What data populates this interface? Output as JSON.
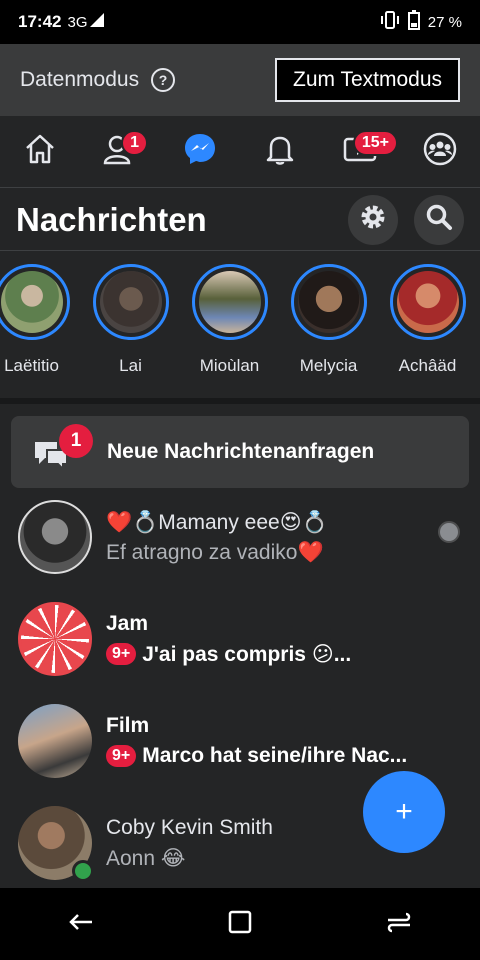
{
  "status_bar": {
    "time": "17:42",
    "network": "3G",
    "network_sup": "3G",
    "battery": "27 %"
  },
  "data_mode": {
    "label": "Datenmodus",
    "help_glyph": "?",
    "text_mode_button": "Zum Textmodus"
  },
  "nav": {
    "items": [
      {
        "name": "home",
        "badge": ""
      },
      {
        "name": "friends",
        "badge": "1"
      },
      {
        "name": "messenger",
        "badge": ""
      },
      {
        "name": "notifications",
        "badge": ""
      },
      {
        "name": "watch",
        "badge": "15+"
      },
      {
        "name": "groups",
        "badge": ""
      }
    ]
  },
  "header": {
    "title": "Nachrichten"
  },
  "stories": [
    {
      "name": "Laëtitio"
    },
    {
      "name": "Lai"
    },
    {
      "name": "Mioùlan"
    },
    {
      "name": "Melycia"
    },
    {
      "name": "Achâäd"
    }
  ],
  "requests": {
    "badge": "1",
    "label": "Neue Nachrichtenanfragen"
  },
  "conversations": [
    {
      "name": "❤️💍Mamany eee😍💍",
      "message": "Ef atragno za vadiko❤️",
      "badge": "",
      "unread": false
    },
    {
      "name": "Jam",
      "message": "J'ai pas compris 😕...",
      "badge": "9+",
      "unread": true
    },
    {
      "name": "Film",
      "message": "Marco hat seine/ihre Nac...",
      "badge": "9+",
      "unread": true
    },
    {
      "name": "Coby Kevin Smith",
      "message": "Aonn 😂",
      "badge": "",
      "unread": false
    }
  ],
  "fab": {
    "label": "+"
  },
  "colors": {
    "accent": "#2d88ff",
    "badge": "#e41e3f",
    "background": "#242526",
    "online": "#31a24c"
  }
}
